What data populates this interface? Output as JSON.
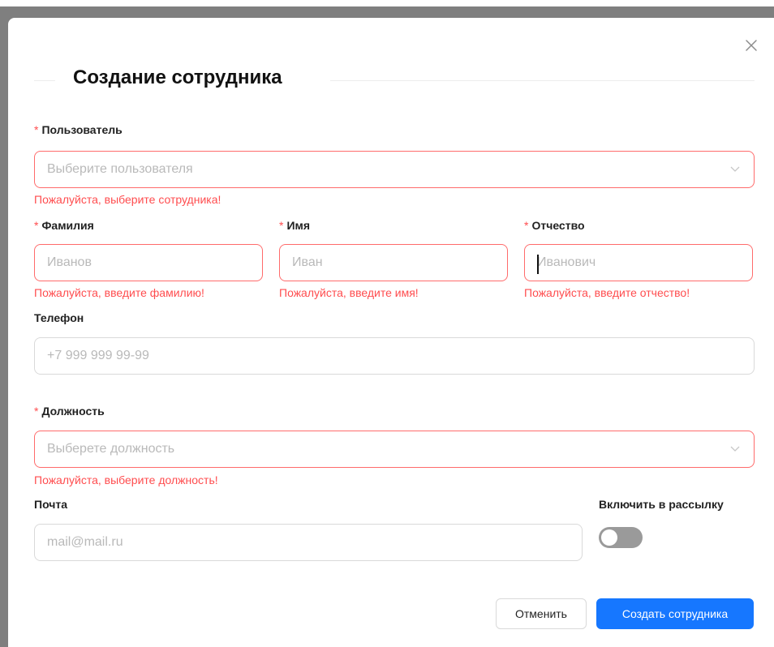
{
  "dialog": {
    "title": "Создание сотрудника",
    "close_icon": "close-icon"
  },
  "fields": {
    "user": {
      "label": "Пользователь",
      "required_mark": "*",
      "placeholder": "Выберите пользователя",
      "error": "Пожалуйста, выберите сотрудника!"
    },
    "last_name": {
      "label": "Фамилия",
      "required_mark": "*",
      "placeholder": "Иванов",
      "value": "",
      "error": "Пожалуйста, введите фамилию!"
    },
    "first_name": {
      "label": "Имя",
      "required_mark": "*",
      "placeholder": "Иван",
      "value": "",
      "error": "Пожалуйста, введите имя!"
    },
    "middle_name": {
      "label": "Отчество",
      "required_mark": "*",
      "placeholder": "Иванович",
      "value": "",
      "error": "Пожалуйста, введите отчество!"
    },
    "phone": {
      "label": "Телефон",
      "placeholder": "+7 999 999 99-99",
      "value": ""
    },
    "position": {
      "label": "Должность",
      "required_mark": "*",
      "placeholder": "Выберете должность",
      "error": "Пожалуйста, выберите должность!"
    },
    "email": {
      "label": "Почта",
      "placeholder": "mail@mail.ru",
      "value": ""
    },
    "newsletter": {
      "label": "Включить в рассылку",
      "enabled": false
    }
  },
  "buttons": {
    "cancel": "Отменить",
    "create": "Создать сотрудника"
  },
  "colors": {
    "error": "#ff4d4f",
    "primary": "#1677ff"
  }
}
